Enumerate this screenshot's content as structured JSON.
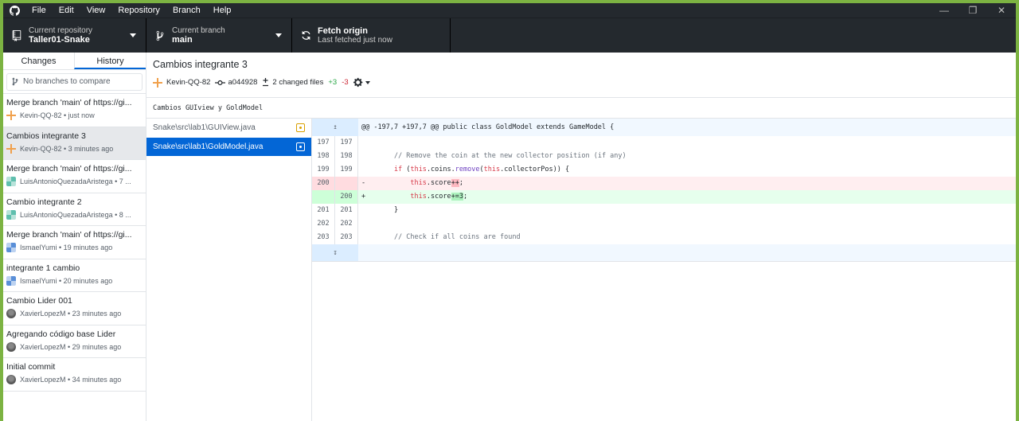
{
  "menu": [
    "File",
    "Edit",
    "View",
    "Repository",
    "Branch",
    "Help"
  ],
  "window_controls": [
    "minimize",
    "restore",
    "close"
  ],
  "toolbar": {
    "repo_label": "Current repository",
    "repo_value": "Taller01-Snake",
    "branch_label": "Current branch",
    "branch_value": "main",
    "fetch_label": "Fetch origin",
    "fetch_sub": "Last fetched just now"
  },
  "sidebar": {
    "tabs": [
      "Changes",
      "History"
    ],
    "active_tab": "History",
    "compare_placeholder": "No branches to compare",
    "commits": [
      {
        "title": "Merge branch 'main' of https://gi...",
        "meta": "Kevin-QQ-82 • just now",
        "avatar": "orange"
      },
      {
        "title": "Cambios integrante 3",
        "meta": "Kevin-QQ-82 • 3 minutes ago",
        "avatar": "orange"
      },
      {
        "title": "Merge branch 'main' of https://gi...",
        "meta": "LuisAntonioQuezadaAristega • 7 ...",
        "avatar": "teal"
      },
      {
        "title": "Cambio integrante 2",
        "meta": "LuisAntonioQuezadaAristega • 8 ...",
        "avatar": "teal"
      },
      {
        "title": "Merge branch 'main' of https://gi...",
        "meta": "IsmaelYumi • 19 minutes ago",
        "avatar": "blue"
      },
      {
        "title": "integrante 1 cambio",
        "meta": "IsmaelYumi • 20 minutes ago",
        "avatar": "blue"
      },
      {
        "title": "Cambio Lider 001",
        "meta": "XavierLopezM • 23 minutes ago",
        "avatar": "gray"
      },
      {
        "title": "Agregando código base Lider",
        "meta": "XavierLopezM • 29 minutes ago",
        "avatar": "gray"
      },
      {
        "title": "Initial commit",
        "meta": "XavierLopezM • 34 minutes ago",
        "avatar": "gray"
      }
    ]
  },
  "commit": {
    "title": "Cambios integrante 3",
    "author": "Kevin-QQ-82",
    "sha": "a044928",
    "files_changed": "2 changed files",
    "additions": "+3",
    "deletions": "-3",
    "description": "Cambios GUIview y GoldModel"
  },
  "files": [
    {
      "path": "Snake\\src\\lab1\\GUIView.java",
      "status": "modified"
    },
    {
      "path": "Snake\\src\\lab1\\GoldModel.java",
      "status": "modified"
    }
  ],
  "diff": {
    "hunk_header": "@@ -197,7 +197,7 @@ public class GoldModel extends GameModel {",
    "lines": [
      {
        "old": "197",
        "new": "197",
        "type": "ctx"
      },
      {
        "old": "198",
        "new": "198",
        "type": "ctx"
      },
      {
        "old": "199",
        "new": "199",
        "type": "ctx"
      },
      {
        "old": "200",
        "new": "",
        "type": "del"
      },
      {
        "old": "",
        "new": "200",
        "type": "add"
      },
      {
        "old": "201",
        "new": "201",
        "type": "ctx"
      },
      {
        "old": "202",
        "new": "202",
        "type": "ctx"
      },
      {
        "old": "203",
        "new": "203",
        "type": "ctx"
      }
    ],
    "code": {
      "l198": "// Remove the coin at the new collector position (if any)",
      "l199_kw": "if",
      "l199_a": " (",
      "l199_this1": "this",
      "l199_b": ".coins.",
      "l199_remove": "remove",
      "l199_c": "(",
      "l199_this2": "this",
      "l199_d": ".collectorPos)) {",
      "del_sign": "-",
      "del_this": "this",
      "del_a": ".score",
      "del_hl": "++",
      "del_b": ";",
      "add_sign": "+",
      "add_this": "this",
      "add_a": ".score",
      "add_hl": "+=3",
      "add_b": ";",
      "l201": "}",
      "l203": "// Check if all coins are found"
    }
  }
}
